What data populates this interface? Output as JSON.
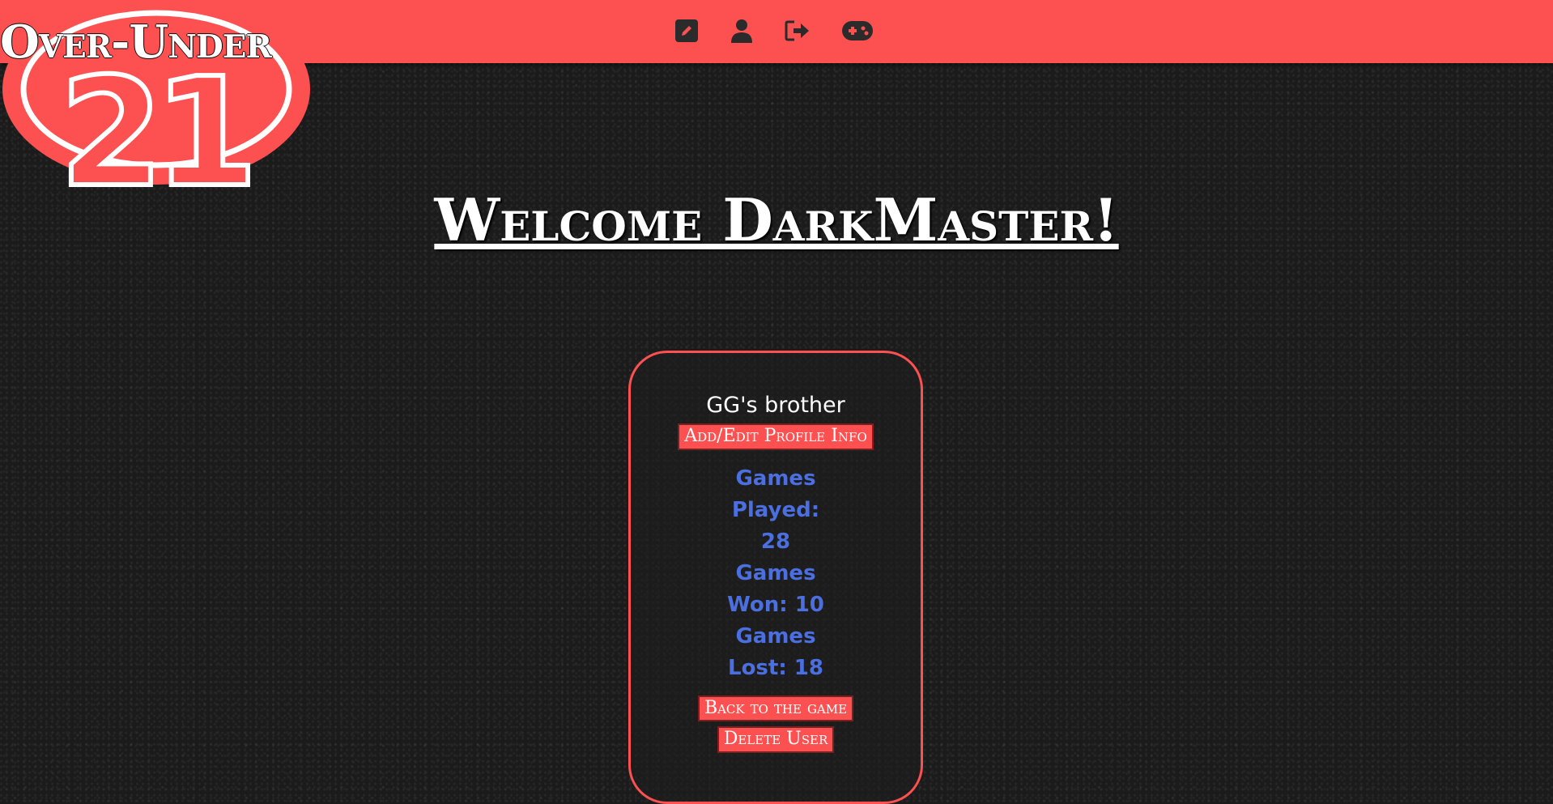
{
  "logo": {
    "title": "Over-Under",
    "number": "21"
  },
  "nav": {
    "icons": [
      {
        "name": "edit-icon"
      },
      {
        "name": "user-icon"
      },
      {
        "name": "logout-icon"
      },
      {
        "name": "gamepad-icon"
      }
    ]
  },
  "page": {
    "title": "Welcome DarkMaster!"
  },
  "profile": {
    "bio": "GG's brother",
    "edit_label": "Add/Edit Profile Info",
    "stats": {
      "played_label": "Games Played:",
      "played": "28",
      "won_label": "Games Won:",
      "won": "10",
      "lost_label": "Games Lost:",
      "lost": "18"
    },
    "back_label": "Back to the game",
    "delete_label": "Delete User"
  },
  "colors": {
    "accent": "#fd5151",
    "stats_text": "#4b6fe0",
    "background": "#1b1b1b"
  }
}
